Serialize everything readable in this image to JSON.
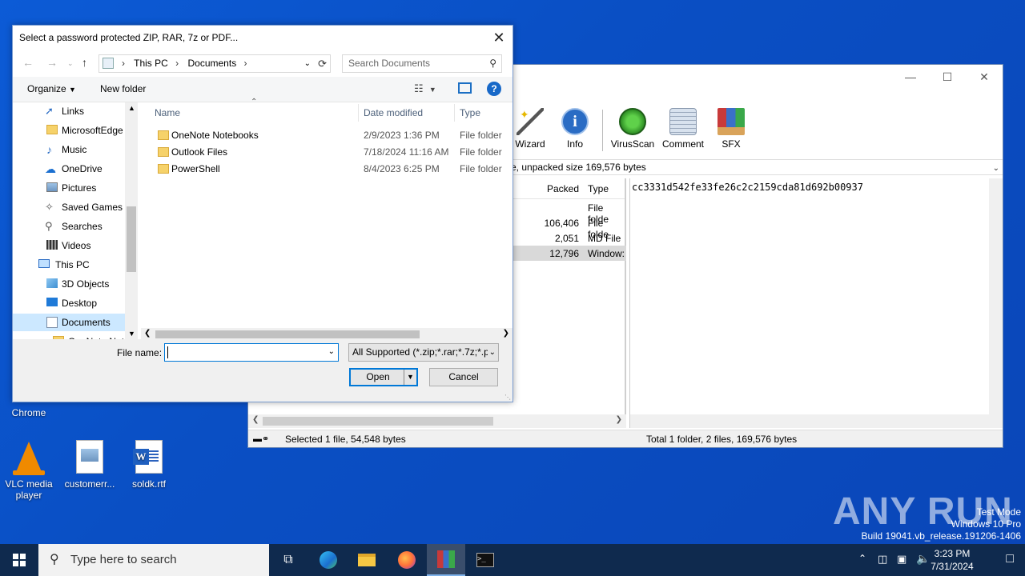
{
  "desktop": {
    "icons": [
      {
        "label": "Chrome"
      },
      {
        "label": "VLC media player"
      },
      {
        "label": "customerr..."
      },
      {
        "label": "soldk.rtf"
      }
    ]
  },
  "winrar": {
    "toolbar": [
      {
        "label": "Wizard",
        "icon": "wizard-icon"
      },
      {
        "label": "Info",
        "icon": "info-icon"
      },
      {
        "label": "VirusScan",
        "icon": "virusscan-icon"
      },
      {
        "label": "Comment",
        "icon": "comment-icon"
      },
      {
        "label": "SFX",
        "icon": "sfx-icon"
      }
    ],
    "path_text": "e, unpacked size 169,576 bytes",
    "columns": {
      "packed": "Packed",
      "type": "Type"
    },
    "rows": [
      {
        "packed": "",
        "type": "File folde"
      },
      {
        "packed": "106,406",
        "type": "File folde"
      },
      {
        "packed": "2,051",
        "type": "MD File"
      },
      {
        "packed": "12,796",
        "type": "Window:"
      }
    ],
    "hash": "cc3331d542fe33fe26c2c2159cda81d692b00937",
    "status_left": "Selected 1 file, 54,548 bytes",
    "status_right": "Total 1 folder, 2 files, 169,576 bytes"
  },
  "dialog": {
    "title": "Select a password protected ZIP, RAR, 7z or PDF...",
    "breadcrumb": [
      "This PC",
      "Documents"
    ],
    "search_placeholder": "Search Documents",
    "organize": "Organize",
    "new_folder": "New folder",
    "nav_items": [
      {
        "label": "Links",
        "icon": "links-icon"
      },
      {
        "label": "MicrosoftEdge",
        "icon": "folder-icon"
      },
      {
        "label": "Music",
        "icon": "music-icon"
      },
      {
        "label": "OneDrive",
        "icon": "onedrive-icon"
      },
      {
        "label": "Pictures",
        "icon": "pictures-icon"
      },
      {
        "label": "Saved Games",
        "icon": "saved-games-icon"
      },
      {
        "label": "Searches",
        "icon": "searches-icon"
      },
      {
        "label": "Videos",
        "icon": "videos-icon"
      },
      {
        "label": "This PC",
        "icon": "this-pc-icon"
      },
      {
        "label": "3D Objects",
        "icon": "3d-objects-icon"
      },
      {
        "label": "Desktop",
        "icon": "desktop-icon"
      },
      {
        "label": "Documents",
        "icon": "documents-icon"
      },
      {
        "label": "OneNote Not",
        "icon": "folder-icon"
      }
    ],
    "columns": {
      "name": "Name",
      "date": "Date modified",
      "type": "Type"
    },
    "files": [
      {
        "name": "OneNote Notebooks",
        "date": "2/9/2023 1:36 PM",
        "type": "File folder"
      },
      {
        "name": "Outlook Files",
        "date": "7/18/2024 11:16 AM",
        "type": "File folder"
      },
      {
        "name": "PowerShell",
        "date": "8/4/2023 6:25 PM",
        "type": "File folder"
      }
    ],
    "file_name_label": "File name:",
    "file_name_value": "",
    "filter": "All Supported (*.zip;*.rar;*.7z;*.p",
    "open": "Open",
    "cancel": "Cancel"
  },
  "taskbar": {
    "search_placeholder": "Type here to search",
    "time": "3:23 PM",
    "date": "7/31/2024"
  },
  "watermark": {
    "brand": "ANY RUN",
    "line1": "Test Mode",
    "line2": "Windows 10 Pro",
    "line3": "Build 19041.vb_release.191206-1406"
  },
  "colors": {
    "accent": "#0078d7",
    "desktop": "#0a4fc4",
    "selection": "#cce8ff"
  }
}
